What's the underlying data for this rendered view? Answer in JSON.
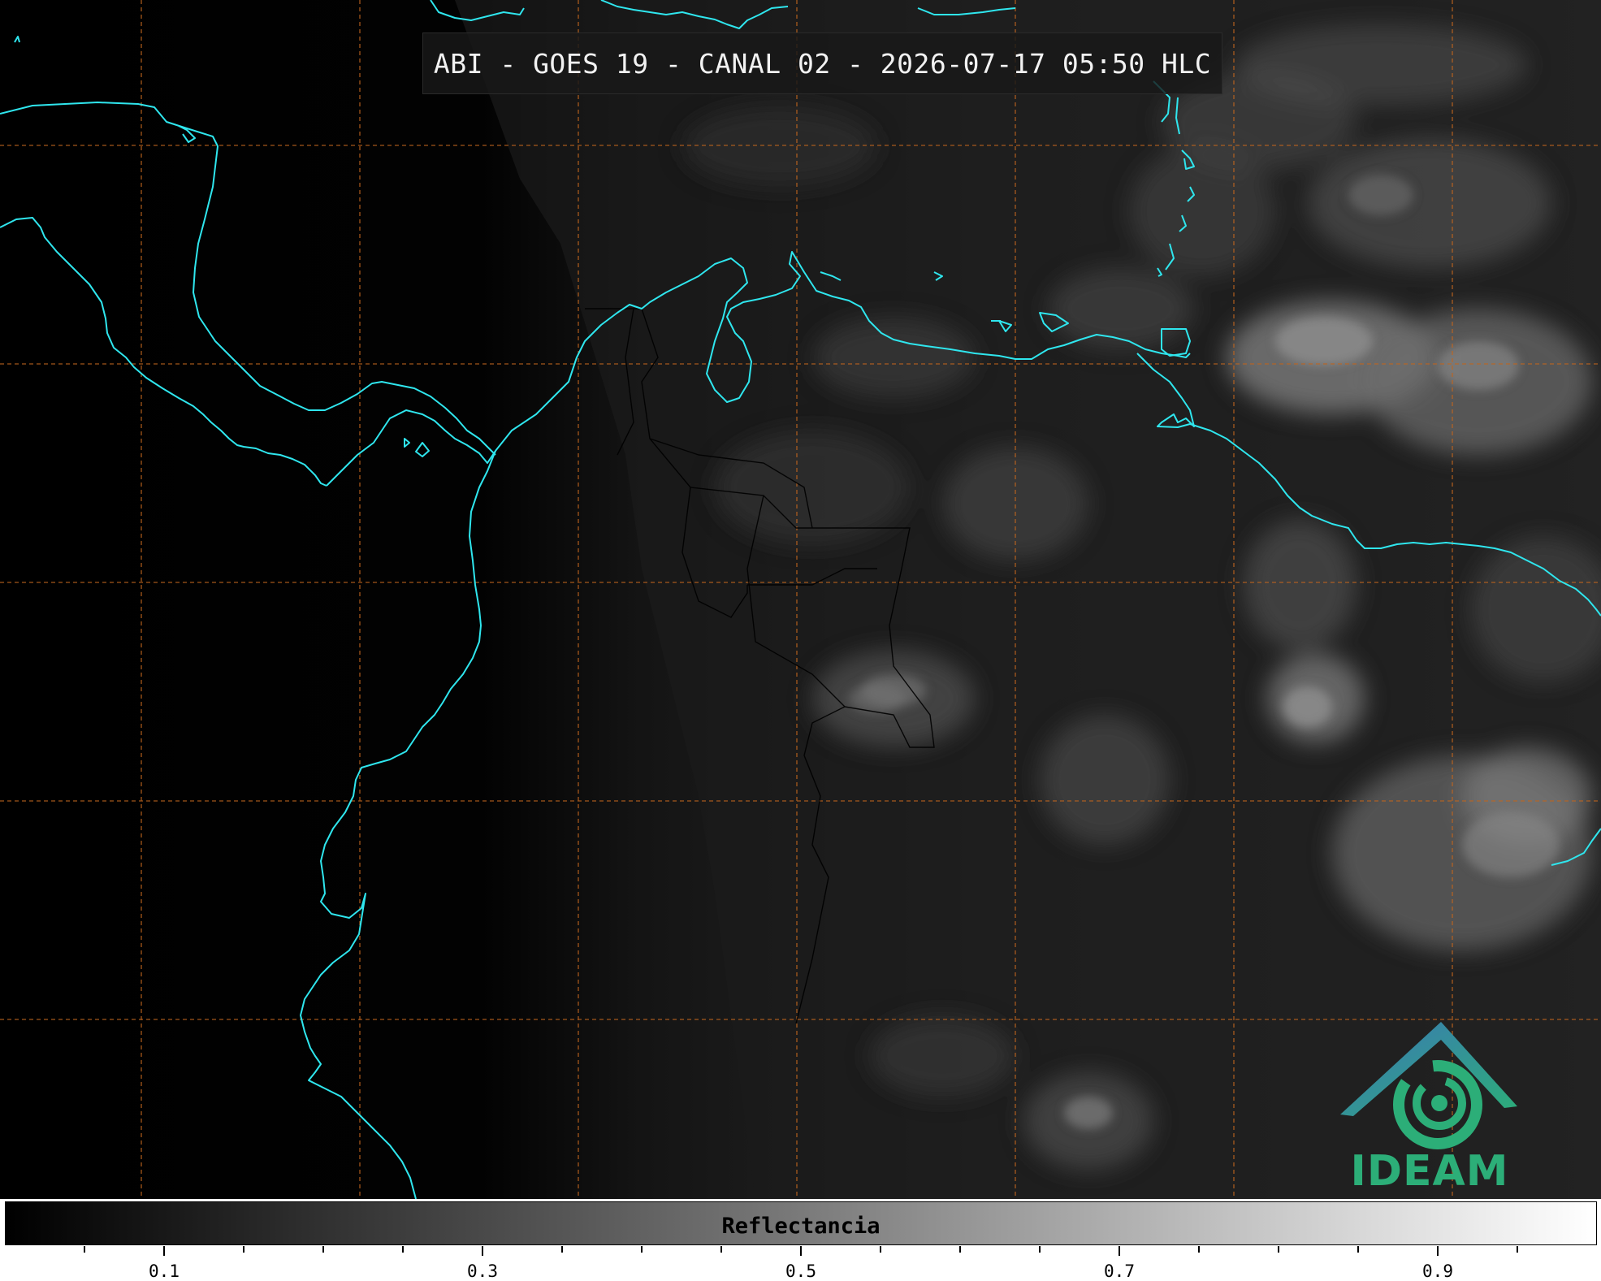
{
  "title": "ABI - GOES 19 - CANAL 02 - 2026-07-17 05:50 HLC",
  "colorbar": {
    "label": "Reflectancia",
    "range": [
      0,
      1
    ],
    "colormap": "grayscale black-to-white",
    "major_ticks": [
      {
        "value": 0.1,
        "label": "0.1"
      },
      {
        "value": 0.3,
        "label": "0.3"
      },
      {
        "value": 0.5,
        "label": "0.5"
      },
      {
        "value": 0.7,
        "label": "0.7"
      },
      {
        "value": 0.9,
        "label": "0.9"
      }
    ]
  },
  "logo": {
    "text": "IDEAM",
    "colors": {
      "roof": "#3b78b5",
      "swirl": "#2cae78"
    }
  },
  "colors": {
    "coastline": "#2fe6ee",
    "grid": "#c0651f",
    "borders": "#000000"
  }
}
